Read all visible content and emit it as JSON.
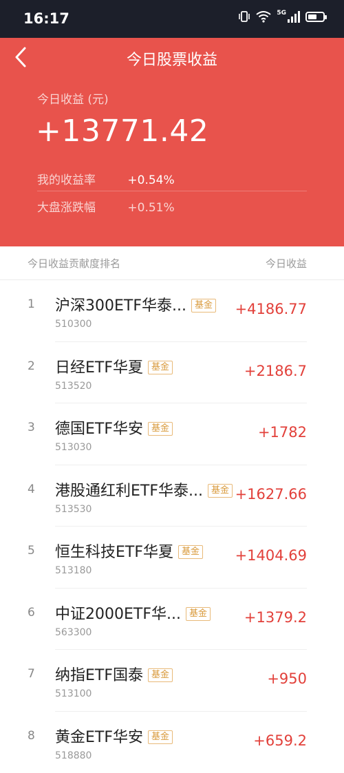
{
  "status_bar": {
    "time": "16:17",
    "icons": [
      "vibrate-icon",
      "wifi-icon",
      "5g-signal-icon",
      "battery-icon"
    ],
    "network_label": "5G"
  },
  "header": {
    "title": "今日股票收益",
    "earnings_label": "今日收益 (元)",
    "earnings_value": "+13771.42",
    "my_rate_label": "我的收益率",
    "my_rate_value": "+0.54%",
    "market_label": "大盘涨跌幅",
    "market_value": "+0.51%",
    "accent_color": "#e8534c"
  },
  "list_header": {
    "left": "今日收益贡献度排名",
    "right": "今日收益"
  },
  "items": [
    {
      "rank": "1",
      "name": "沪深300ETF华泰...",
      "badge": "基金",
      "code": "510300",
      "gain": "+4186.77"
    },
    {
      "rank": "2",
      "name": "日经ETF华夏",
      "badge": "基金",
      "code": "513520",
      "gain": "+2186.7"
    },
    {
      "rank": "3",
      "name": "德国ETF华安",
      "badge": "基金",
      "code": "513030",
      "gain": "+1782"
    },
    {
      "rank": "4",
      "name": "港股通红利ETF华泰...",
      "badge": "基金",
      "code": "513530",
      "gain": "+1627.66"
    },
    {
      "rank": "5",
      "name": "恒生科技ETF华夏",
      "badge": "基金",
      "code": "513180",
      "gain": "+1404.69"
    },
    {
      "rank": "6",
      "name": "中证2000ETF华...",
      "badge": "基金",
      "code": "563300",
      "gain": "+1379.2"
    },
    {
      "rank": "7",
      "name": "纳指ETF国泰",
      "badge": "基金",
      "code": "513100",
      "gain": "+950"
    },
    {
      "rank": "8",
      "name": "黄金ETF华安",
      "badge": "基金",
      "code": "518880",
      "gain": "+659.2"
    }
  ]
}
